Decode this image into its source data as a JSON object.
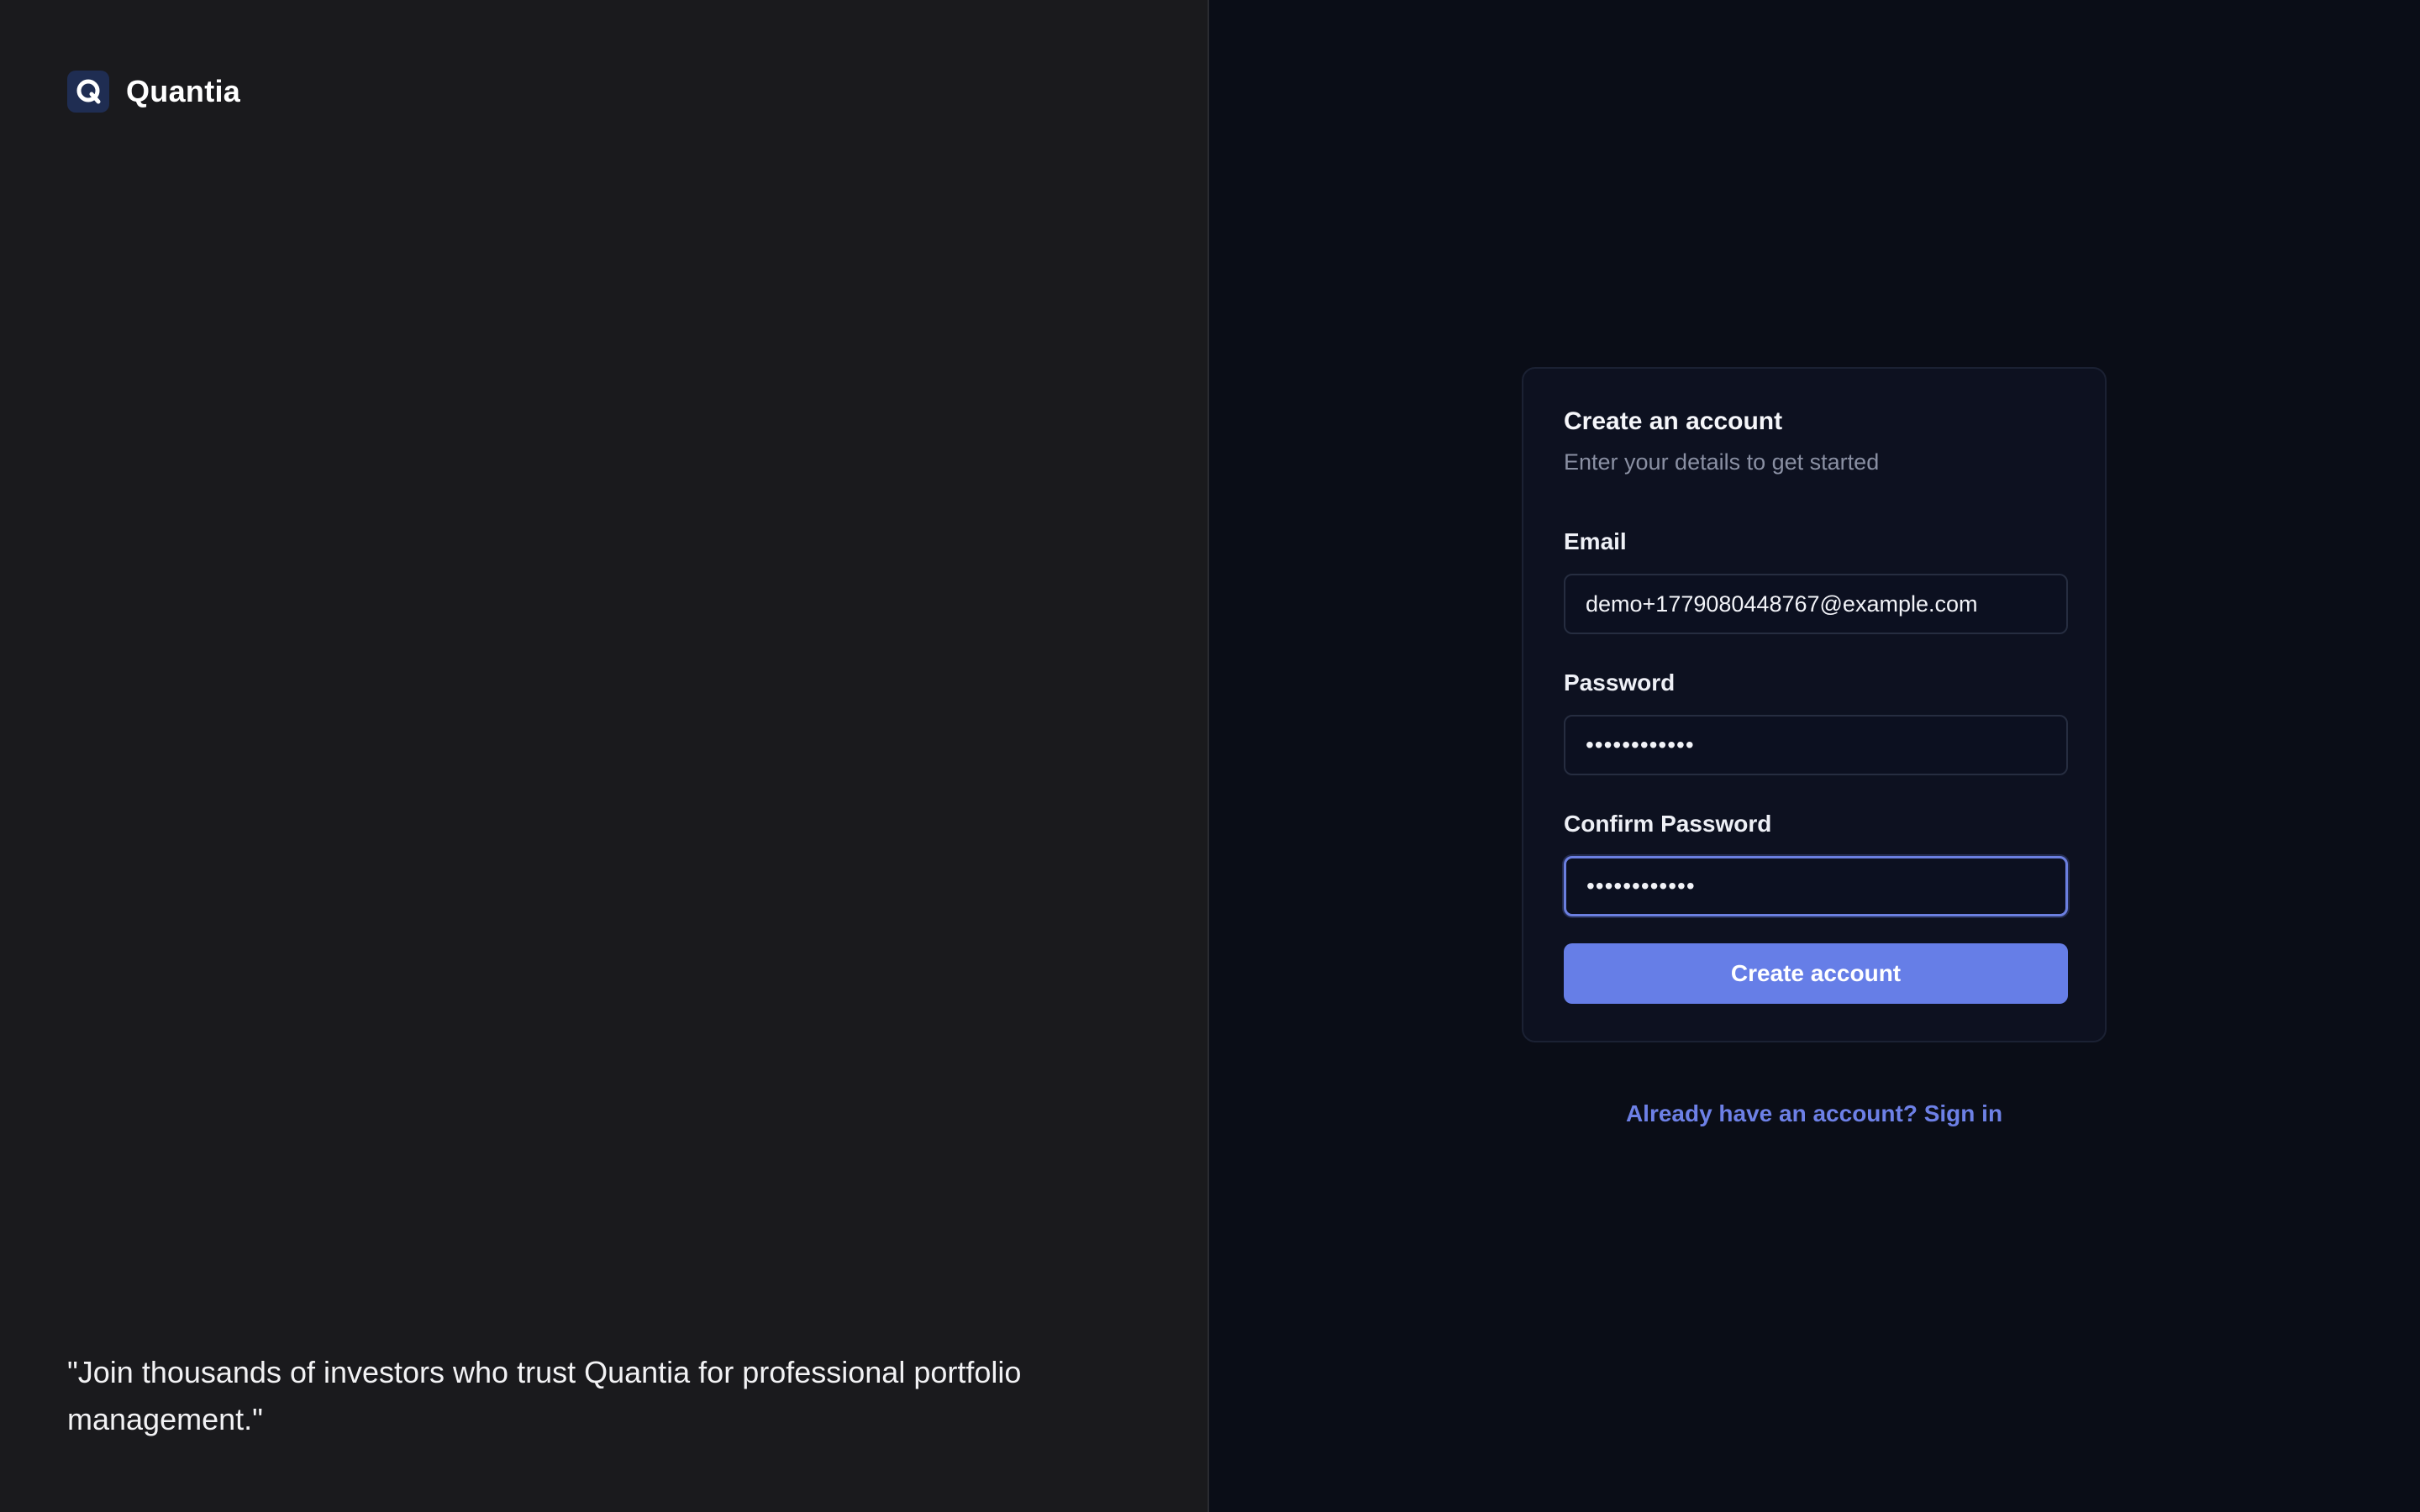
{
  "brand": {
    "name": "Quantia",
    "logo_icon": "q-logo-icon",
    "logo_letter": "Q"
  },
  "quote": {
    "text": "\"Join thousands of investors who trust Quantia for professional portfolio management.\""
  },
  "form": {
    "title": "Create an account",
    "subtitle": "Enter your details to get started",
    "email": {
      "label": "Email",
      "value": "demo+1779080448767@example.com"
    },
    "password": {
      "label": "Password",
      "value": "••••••••••••"
    },
    "confirm_password": {
      "label": "Confirm Password",
      "value": "••••••••••••"
    },
    "submit_label": "Create account"
  },
  "footer": {
    "signin_text": "Already have an account? Sign in"
  },
  "colors": {
    "left_bg": "#1a1a1d",
    "right_bg": "#0a0d17",
    "card_bg": "#0d1120",
    "accent": "#667ee7",
    "link": "#6d80e6"
  }
}
